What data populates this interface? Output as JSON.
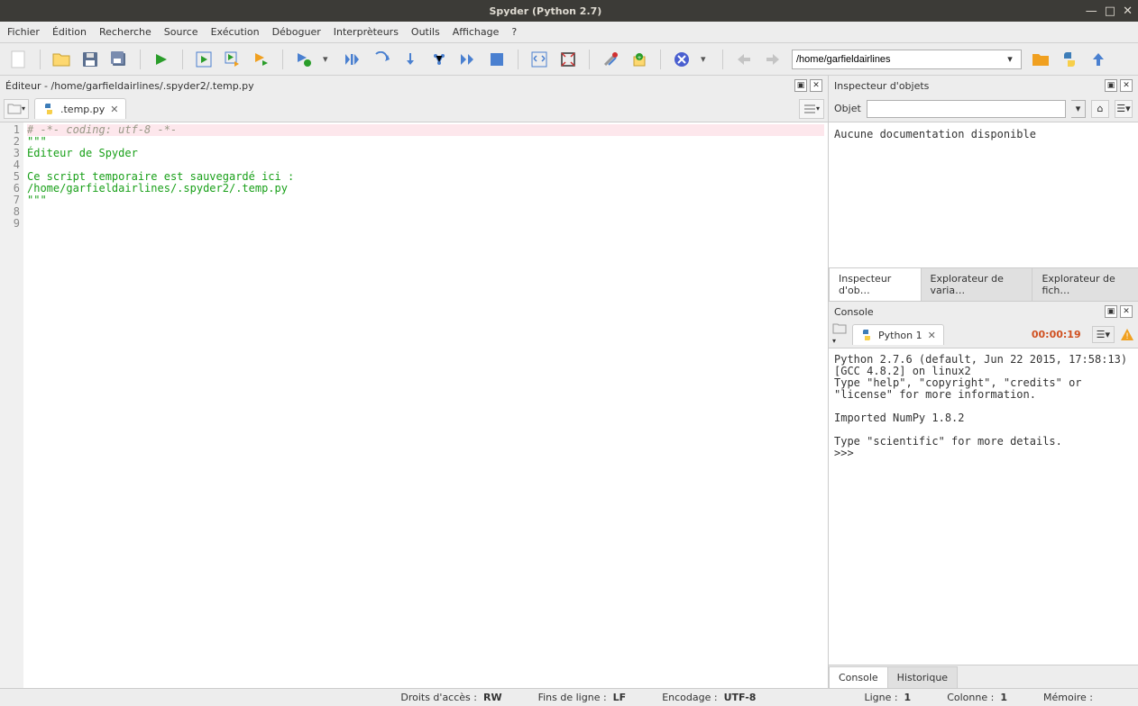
{
  "window": {
    "title": "Spyder (Python 2.7)"
  },
  "menu": [
    "Fichier",
    "Édition",
    "Recherche",
    "Source",
    "Exécution",
    "Déboguer",
    "Interprèteurs",
    "Outils",
    "Affichage",
    "?"
  ],
  "toolbar": {
    "path": "/home/garfieldairlines"
  },
  "editor": {
    "header": "Éditeur - /home/garfieldairlines/.spyder2/.temp.py",
    "tab": ".temp.py",
    "lines": [
      {
        "n": 1,
        "cls": "comment-it hl",
        "text": "# -*- coding: utf-8 -*-"
      },
      {
        "n": 2,
        "cls": "docstring",
        "text": "\"\"\""
      },
      {
        "n": 3,
        "cls": "docstring",
        "text": "Éditeur de Spyder"
      },
      {
        "n": 4,
        "cls": "docstring",
        "text": ""
      },
      {
        "n": 5,
        "cls": "docstring",
        "text": "Ce script temporaire est sauvegardé ici :"
      },
      {
        "n": 6,
        "cls": "docstring",
        "text": "/home/garfieldairlines/.spyder2/.temp.py"
      },
      {
        "n": 7,
        "cls": "docstring",
        "text": "\"\"\""
      },
      {
        "n": 8,
        "cls": "",
        "text": ""
      },
      {
        "n": 9,
        "cls": "",
        "text": ""
      }
    ]
  },
  "inspector": {
    "header": "Inspecteur d'objets",
    "objet_label": "Objet",
    "doc": "Aucune documentation disponible",
    "tabs": [
      "Inspecteur d'ob…",
      "Explorateur de varia…",
      "Explorateur de fich…"
    ]
  },
  "console": {
    "header": "Console",
    "tab": "Python 1",
    "time": "00:00:19",
    "output": "Python 2.7.6 (default, Jun 22 2015, 17:58:13) \n[GCC 4.8.2] on linux2\nType \"help\", \"copyright\", \"credits\" or \"license\" for more information.\n\nImported NumPy 1.8.2\n\nType \"scientific\" for more details.\n>>> ",
    "bottom_tabs": [
      "Console",
      "Historique"
    ]
  },
  "status": {
    "perms_label": "Droits d'accès :",
    "perms": "RW",
    "eol_label": "Fins de ligne :",
    "eol": "LF",
    "enc_label": "Encodage :",
    "enc": "UTF-8",
    "line_label": "Ligne :",
    "line": "1",
    "col_label": "Colonne :",
    "col": "1",
    "mem_label": "Mémoire :"
  }
}
